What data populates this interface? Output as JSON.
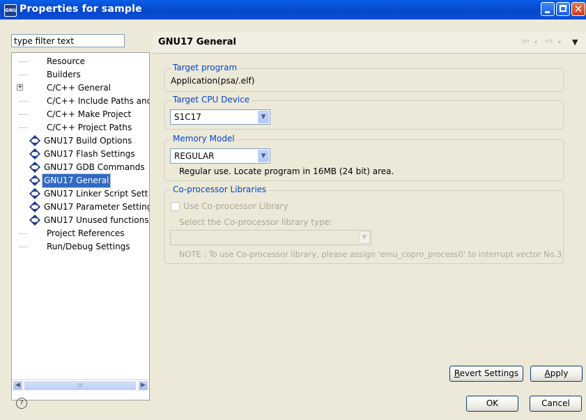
{
  "window": {
    "title": "Properties for sample",
    "app_icon_text": "GNU"
  },
  "filter": {
    "placeholder": "type filter text",
    "value": "type filter text"
  },
  "tree": {
    "items": [
      {
        "label": "Resource",
        "icon": "none",
        "expander": "",
        "selected": false
      },
      {
        "label": "Builders",
        "icon": "none",
        "expander": "",
        "selected": false
      },
      {
        "label": "C/C++ General",
        "icon": "none",
        "expander": "+",
        "selected": false
      },
      {
        "label": "C/C++ Include Paths and",
        "icon": "none",
        "expander": "",
        "selected": false
      },
      {
        "label": "C/C++ Make Project",
        "icon": "none",
        "expander": "",
        "selected": false
      },
      {
        "label": "C/C++ Project Paths",
        "icon": "none",
        "expander": "",
        "selected": false
      },
      {
        "label": "GNU17 Build Options",
        "icon": "gnu-icon",
        "expander": "",
        "selected": false
      },
      {
        "label": "GNU17 Flash Settings",
        "icon": "gnu-icon",
        "expander": "",
        "selected": false
      },
      {
        "label": "GNU17 GDB Commands",
        "icon": "gnu-icon",
        "expander": "",
        "selected": false
      },
      {
        "label": "GNU17 General",
        "icon": "gnu-icon",
        "expander": "",
        "selected": true
      },
      {
        "label": "GNU17 Linker Script Sett",
        "icon": "gnu-icon",
        "expander": "",
        "selected": false
      },
      {
        "label": "GNU17 Parameter Setting",
        "icon": "gnu-icon",
        "expander": "",
        "selected": false
      },
      {
        "label": "GNU17 Unused functions",
        "icon": "gnu-icon",
        "expander": "",
        "selected": false
      },
      {
        "label": "Project References",
        "icon": "none",
        "expander": "",
        "selected": false
      },
      {
        "label": "Run/Debug Settings",
        "icon": "none",
        "expander": "",
        "selected": false
      }
    ],
    "scroll_thumb_mark": "III"
  },
  "page": {
    "title": "GNU17 General",
    "nav": {
      "back": "⇦",
      "fwd": "⇨",
      "dropdown": "▾",
      "menu": "▼"
    },
    "target_program": {
      "label": "Target program",
      "value": "Application(psa/.elf)"
    },
    "target_cpu": {
      "label": "Target CPU Device",
      "selected": "S1C17"
    },
    "memory_model": {
      "label": "Memory Model",
      "selected": "REGULAR",
      "description": "Regular use. Locate program in 16MB (24 bit) area."
    },
    "coproc": {
      "label": "Co-processor Libraries",
      "checkbox_label": "Use Co-processor Library",
      "select_label": "Select the Co-processor library type:",
      "selected": "",
      "note": "NOTE : To use Co-processor library, please assign 'emu_copro_process0' to interrupt vector No.3"
    },
    "buttons": {
      "revert": "Revert Settings",
      "revert_mnemonic": "R",
      "revert_rest": "evert Settings",
      "apply_mnemonic": "A",
      "apply_rest": "pply"
    }
  },
  "footer": {
    "help_icon": "?",
    "ok": "OK",
    "cancel": "Cancel"
  },
  "colors": {
    "titlebar": "#0747c8",
    "selection": "#316ac5",
    "group_label": "#0046d5",
    "dialog_bg": "#ece9d8"
  }
}
